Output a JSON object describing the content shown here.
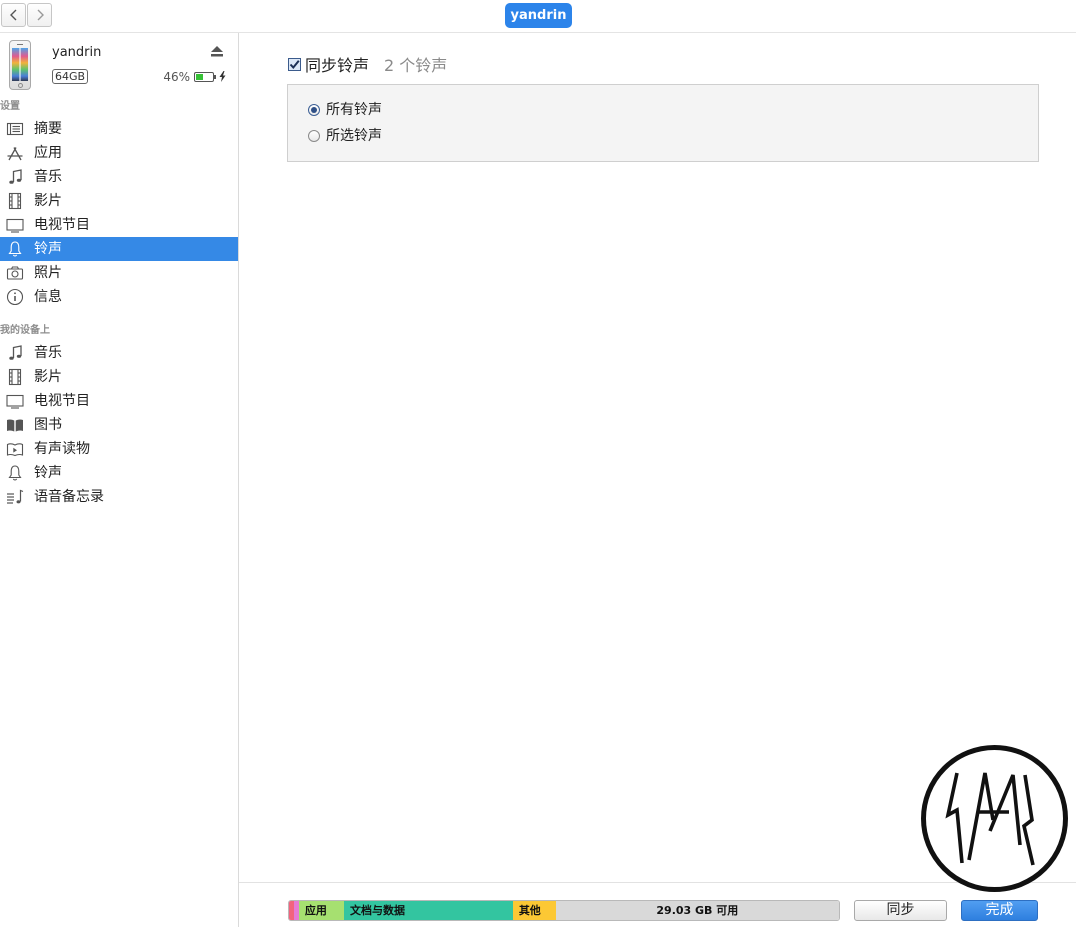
{
  "toolbar": {
    "back_icon": "chevron-left-icon",
    "forward_icon": "chevron-right-icon",
    "device_button": "yandrin"
  },
  "device": {
    "name": "yandrin",
    "capacity": "64GB",
    "battery_text": "46%",
    "battery_level": 0.46,
    "charging": true,
    "eject_icon": "eject-icon"
  },
  "sidebar": {
    "settings": {
      "title": "设置",
      "items": [
        {
          "label": "摘要",
          "icon": "summary-icon",
          "selected": false
        },
        {
          "label": "应用",
          "icon": "apps-icon",
          "selected": false
        },
        {
          "label": "音乐",
          "icon": "music-icon",
          "selected": false
        },
        {
          "label": "影片",
          "icon": "film-icon",
          "selected": false
        },
        {
          "label": "电视节目",
          "icon": "tv-icon",
          "selected": false
        },
        {
          "label": "铃声",
          "icon": "bell-icon",
          "selected": true
        },
        {
          "label": "照片",
          "icon": "camera-icon",
          "selected": false
        },
        {
          "label": "信息",
          "icon": "info-icon",
          "selected": false
        }
      ]
    },
    "on_device": {
      "title": "我的设备上",
      "items": [
        {
          "label": "音乐",
          "icon": "music-icon"
        },
        {
          "label": "影片",
          "icon": "film-icon"
        },
        {
          "label": "电视节目",
          "icon": "tv-icon"
        },
        {
          "label": "图书",
          "icon": "book-icon"
        },
        {
          "label": "有声读物",
          "icon": "audiobook-icon"
        },
        {
          "label": "铃声",
          "icon": "bell-icon"
        },
        {
          "label": "语音备忘录",
          "icon": "voice-memo-icon"
        }
      ]
    }
  },
  "main": {
    "sync_label": "同步铃声",
    "sync_checked": true,
    "count_text": "2 个铃声",
    "options": [
      {
        "label": "所有铃声",
        "selected": true
      },
      {
        "label": "所选铃声",
        "selected": false
      }
    ]
  },
  "storage": {
    "segments": [
      {
        "label": "",
        "fraction": 0.009,
        "color": "#f2647e"
      },
      {
        "label": "",
        "fraction": 0.009,
        "color": "#e67bd6"
      },
      {
        "label": "应用",
        "fraction": 0.082,
        "color": "#a6e070"
      },
      {
        "label": "文档与数据",
        "fraction": 0.307,
        "color": "#33c5a0"
      },
      {
        "label": "其他",
        "fraction": 0.078,
        "color": "#fcc834"
      },
      {
        "label": "29.03 GB 可用",
        "fraction": 0.515,
        "color": "#d9d9d9"
      }
    ],
    "sync_button": "同步",
    "done_button": "完成"
  },
  "colors": {
    "accent": "#2c84ea",
    "selection": "#3589e6",
    "battery": "#36c136"
  }
}
